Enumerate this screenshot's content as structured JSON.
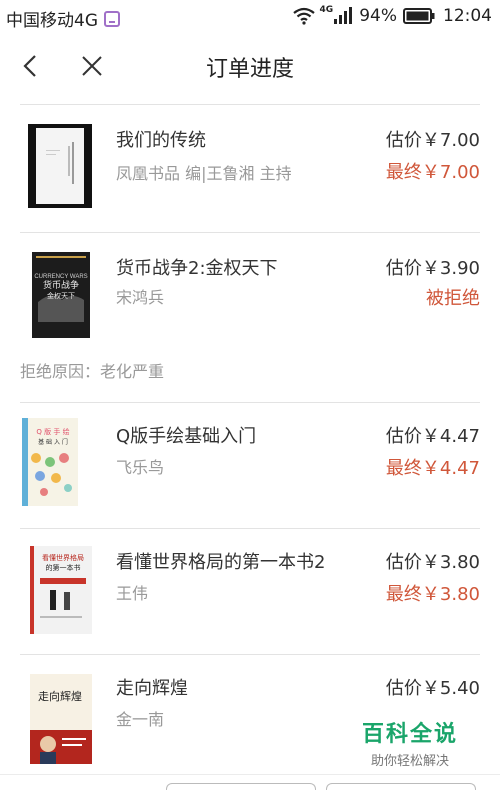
{
  "status": {
    "carrier": "中国移动4G",
    "network": "4G",
    "battery": "94%",
    "time": "12:04"
  },
  "nav": {
    "title": "订单进度"
  },
  "items": [
    {
      "name": "我们的传统",
      "author": "凤凰书品 编|王鲁湘 主持",
      "estimate": "估价￥7.00",
      "final": "最终￥7.00"
    },
    {
      "name": "货币战争2:金权天下",
      "author": "宋鸿兵",
      "estimate": "估价￥3.90",
      "status": "被拒绝",
      "reject_reason": "拒绝原因：老化严重",
      "cover_text": "CURRENCY WARS",
      "cover_title": "货币战争",
      "cover_sub": "金权天下"
    },
    {
      "name": "Q版手绘基础入门",
      "author": "飞乐鸟",
      "estimate": "估价￥4.47",
      "final": "最终￥4.47",
      "cover_title": "Q 版 手 绘",
      "cover_sub": "基 础 入 门"
    },
    {
      "name": "看懂世界格局的第一本书2",
      "author": "王伟",
      "estimate": "估价￥3.80",
      "final": "最终￥3.80",
      "cover_title": "看懂世界格局",
      "cover_sub": "的第一本书"
    },
    {
      "name": "走向辉煌",
      "author": "金一南",
      "estimate": "估价￥5.40",
      "cover_title": "走向辉煌"
    }
  ],
  "watermark": {
    "main": "百科全说",
    "sub": "助你轻松解决"
  },
  "colors": {
    "accent": "#d0573a",
    "watermark": "#1aa56a"
  }
}
